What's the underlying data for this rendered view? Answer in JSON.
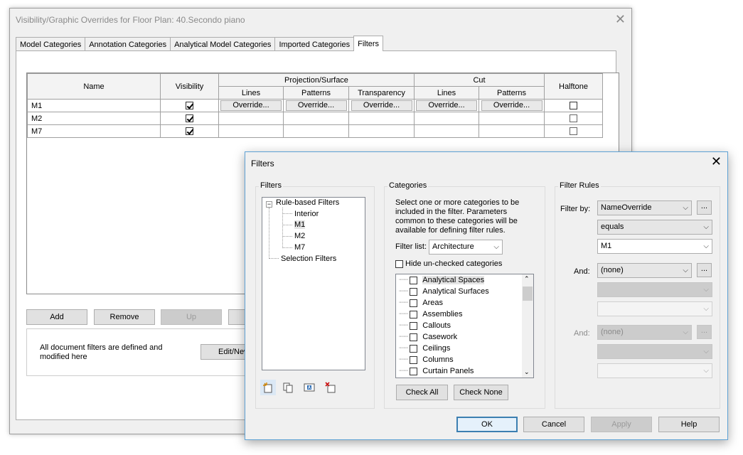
{
  "back_window": {
    "title": "Visibility/Graphic Overrides for Floor Plan: 40.Secondo piano",
    "tabs": [
      "Model Categories",
      "Annotation Categories",
      "Analytical Model Categories",
      "Imported Categories",
      "Filters"
    ],
    "active_tab": "Filters",
    "table": {
      "headers": {
        "name": "Name",
        "visibility": "Visibility",
        "projection_surface": "Projection/Surface",
        "cut": "Cut",
        "halftone": "Halftone",
        "lines": "Lines",
        "patterns": "Patterns",
        "transparency": "Transparency",
        "cut_lines": "Lines",
        "cut_patterns": "Patterns"
      },
      "rows": [
        {
          "name": "M1",
          "visible": true,
          "halftone": false,
          "override": "Override..."
        },
        {
          "name": "M2",
          "visible": true,
          "halftone": false
        },
        {
          "name": "M7",
          "visible": true,
          "halftone": false
        }
      ]
    },
    "buttons": {
      "add": "Add",
      "remove": "Remove",
      "up": "Up"
    },
    "info_text": "All document filters are defined and modified here",
    "edit_new": "Edit/New"
  },
  "filters_dialog": {
    "title": "Filters",
    "filters_group": "Filters",
    "tree": {
      "root": "Rule-based Filters",
      "children": [
        "Interior",
        "M1",
        "M2",
        "M7"
      ],
      "selected": "M1",
      "selection_filters": "Selection Filters"
    },
    "categories_group": "Categories",
    "categories_desc": "Select one or more categories to be included in the filter.  Parameters common to these categories will be available for defining filter rules.",
    "filter_list_label": "Filter list:",
    "filter_list_value": "Architecture",
    "hide_unchecked": "Hide un-checked categories",
    "categories": [
      "Analytical Spaces",
      "Analytical Surfaces",
      "Areas",
      "Assemblies",
      "Callouts",
      "Casework",
      "Ceilings",
      "Columns",
      "Curtain Panels"
    ],
    "check_all": "Check All",
    "check_none": "Check None",
    "rules_group": "Filter Rules",
    "filter_by_label": "Filter by:",
    "filter_by_value": "NameOverride",
    "operator_value": "equals",
    "rule_value": "M1",
    "and_label": "And:",
    "and1_value": "(none)",
    "and2_label": "And:",
    "and2_value": "(none)",
    "ellipsis": "...",
    "buttons": {
      "ok": "OK",
      "cancel": "Cancel",
      "apply": "Apply",
      "help": "Help"
    }
  }
}
